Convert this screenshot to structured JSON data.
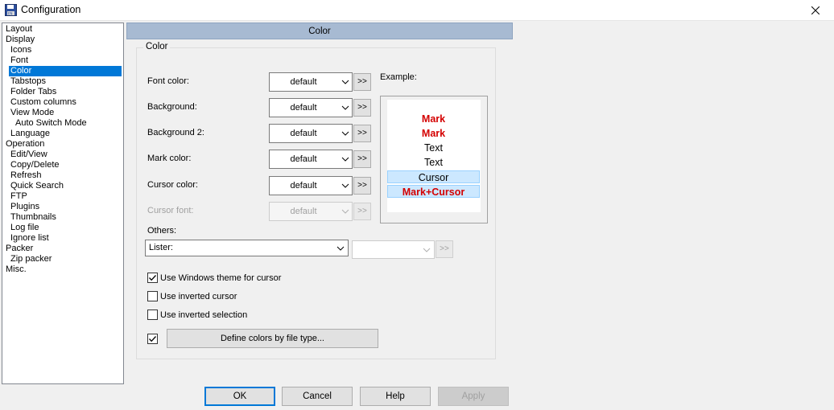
{
  "window": {
    "title": "Configuration"
  },
  "tree": {
    "items": [
      {
        "label": "Layout",
        "level": 0
      },
      {
        "label": "Display",
        "level": 0
      },
      {
        "label": "Icons",
        "level": 1
      },
      {
        "label": "Font",
        "level": 1
      },
      {
        "label": "Color",
        "level": 1,
        "selected": true
      },
      {
        "label": "Tabstops",
        "level": 1
      },
      {
        "label": "Folder Tabs",
        "level": 1
      },
      {
        "label": "Custom columns",
        "level": 1
      },
      {
        "label": "View Mode",
        "level": 1
      },
      {
        "label": "Auto Switch Mode",
        "level": 2
      },
      {
        "label": "Language",
        "level": 1
      },
      {
        "label": "Operation",
        "level": 0
      },
      {
        "label": "Edit/View",
        "level": 1
      },
      {
        "label": "Copy/Delete",
        "level": 1
      },
      {
        "label": "Refresh",
        "level": 1
      },
      {
        "label": "Quick Search",
        "level": 1
      },
      {
        "label": "FTP",
        "level": 1
      },
      {
        "label": "Plugins",
        "level": 1
      },
      {
        "label": "Thumbnails",
        "level": 1
      },
      {
        "label": "Log file",
        "level": 1
      },
      {
        "label": "Ignore list",
        "level": 1
      },
      {
        "label": "Packer",
        "level": 0
      },
      {
        "label": "Zip packer",
        "level": 1
      },
      {
        "label": "Misc.",
        "level": 0
      }
    ]
  },
  "section": {
    "title": "Color"
  },
  "group": {
    "title": "Color"
  },
  "rows": {
    "font": {
      "label": "Font color:",
      "value": "default",
      "button": ">>"
    },
    "background": {
      "label": "Background:",
      "value": "default",
      "button": ">>"
    },
    "background2": {
      "label": "Background 2:",
      "value": "default",
      "button": ">>"
    },
    "mark": {
      "label": "Mark color:",
      "value": "default",
      "button": ">>"
    },
    "cursor": {
      "label": "Cursor color:",
      "value": "default",
      "button": ">>"
    },
    "cursorfont": {
      "label": "Cursor font:",
      "value": "default",
      "button": ">>"
    }
  },
  "example": {
    "label": "Example:",
    "lines": [
      "Mark",
      "Mark",
      "Text",
      "Text",
      "Cursor",
      "Mark+Cursor"
    ]
  },
  "others": {
    "label": "Others:",
    "selected": "Lister:",
    "button": ">>"
  },
  "checkboxes": {
    "windows_theme": {
      "label": "Use Windows theme for cursor",
      "checked": true
    },
    "inverted_cursor": {
      "label": "Use inverted cursor",
      "checked": false
    },
    "inverted_selection": {
      "label": "Use inverted selection",
      "checked": false
    },
    "define_by_type": {
      "checked": true
    }
  },
  "define_button": {
    "label": "Define colors by file type..."
  },
  "buttons": {
    "ok": "OK",
    "cancel": "Cancel",
    "help": "Help",
    "apply": "Apply"
  },
  "colors": {
    "accent": "#0078d7",
    "mark": "#d40000",
    "cursor_bg": "#cce8ff",
    "header_bg": "#a7bad2"
  }
}
